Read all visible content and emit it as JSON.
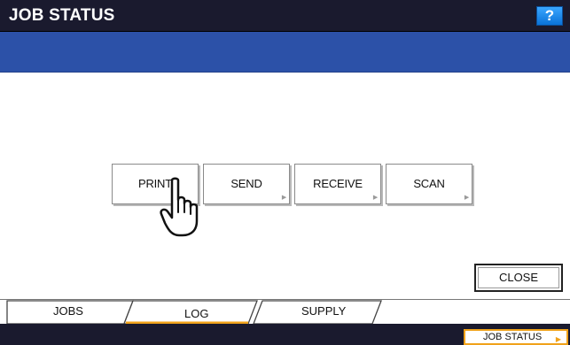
{
  "header": {
    "title": "JOB STATUS",
    "help_label": "?"
  },
  "log_categories": [
    {
      "label": "PRINT"
    },
    {
      "label": "SEND"
    },
    {
      "label": "RECEIVE"
    },
    {
      "label": "SCAN"
    }
  ],
  "actions": {
    "close_label": "CLOSE"
  },
  "tabs": [
    {
      "label": "JOBS",
      "active": false
    },
    {
      "label": "LOG",
      "active": true
    },
    {
      "label": "SUPPLY",
      "active": false
    }
  ],
  "statusbar": {
    "job_status_label": "JOB STATUS"
  },
  "colors": {
    "titlebar": "#1a1a2e",
    "band": "#2c51a8",
    "help_button": "#0a72d8",
    "active_tab_accent": "#f0a21a"
  }
}
